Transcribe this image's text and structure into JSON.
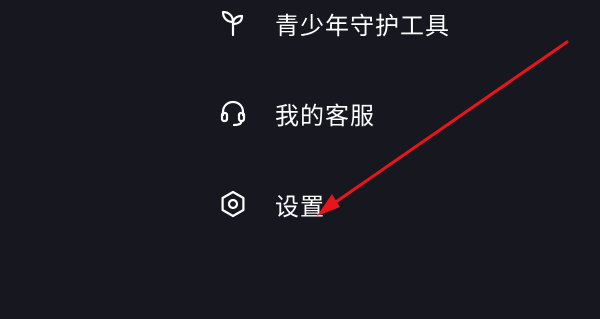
{
  "menu": {
    "items": [
      {
        "label": "青少年守护工具",
        "icon": "sprout-icon"
      },
      {
        "label": "我的客服",
        "icon": "headset-icon"
      },
      {
        "label": "设置",
        "icon": "settings-hexagon-icon"
      }
    ]
  },
  "annotation": {
    "arrow_color": "#e8151b",
    "points_to": "设置"
  },
  "colors": {
    "background": "#16171f",
    "text": "#ffffff"
  }
}
